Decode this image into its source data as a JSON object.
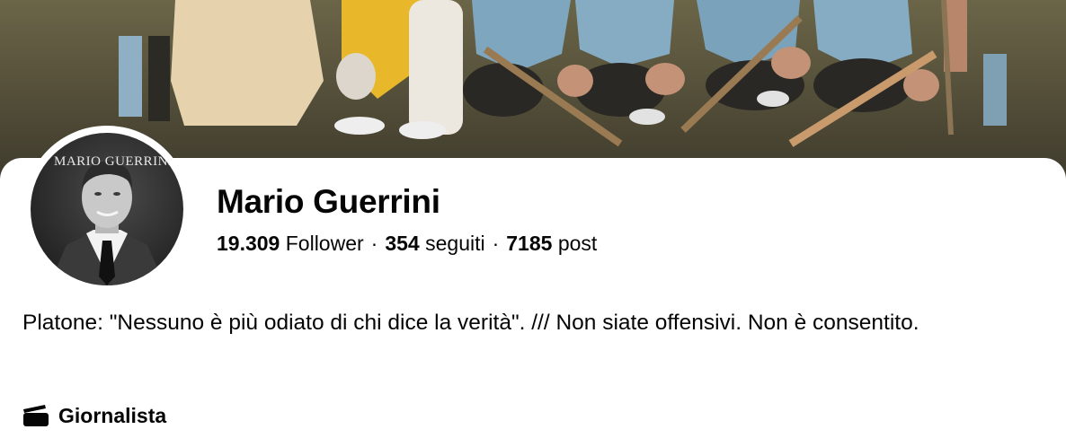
{
  "cover_photo": {
    "icon": "team-group-photo"
  },
  "avatar": {
    "brand_text": "MARIO GUERRINI"
  },
  "profile": {
    "name": "Mario Guerrini",
    "followers_count": "19.309",
    "followers_label": "Follower",
    "following_count": "354",
    "following_label": "seguiti",
    "posts_count": "7185",
    "posts_label": "post",
    "separator": "·"
  },
  "bio": "Platone: \"Nessuno è più odiato di chi dice la verità\". /// Non siate offensivi. Non è consentito.",
  "category": {
    "icon": "clapperboard-icon",
    "label": "Giornalista"
  }
}
